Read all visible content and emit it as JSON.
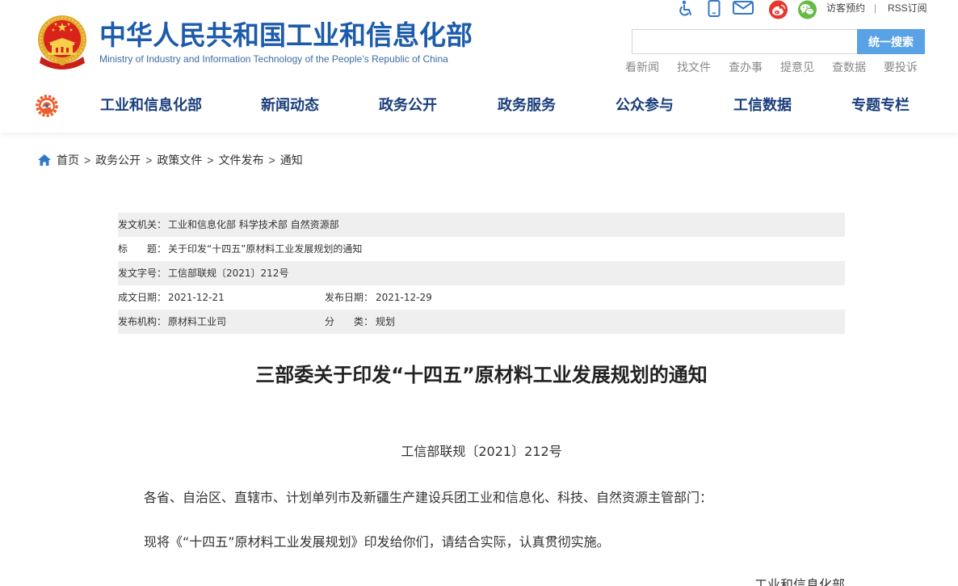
{
  "header": {
    "title": "中华人民共和国工业和信息化部",
    "subtitle": "Ministry of Industry and Information Technology of the People’s Republic of China",
    "top_links": {
      "visitor": "访客预约",
      "separator": "|",
      "rss": "RSS订阅"
    },
    "search": {
      "button_label": "统一搜索"
    },
    "quick_links": [
      "看新闻",
      "找文件",
      "查办事",
      "提意见",
      "查数据",
      "要投诉"
    ]
  },
  "nav": {
    "items": [
      "工业和信息化部",
      "新闻动态",
      "政务公开",
      "政务服务",
      "公众参与",
      "工信数据",
      "专题专栏"
    ]
  },
  "breadcrumb": {
    "items": [
      "首页",
      "政务公开",
      "政策文件",
      "文件发布",
      "通知"
    ],
    "separator": ">"
  },
  "doc_info": {
    "issuer": {
      "label": "发文机关：",
      "value": "工业和信息化部 科学技术部 自然资源部"
    },
    "title": {
      "label": "标　　题：",
      "value": "关于印发“十四五”原材料工业发展规划的通知"
    },
    "doc_no": {
      "label": "发文字号：",
      "value": "工信部联规〔2021〕212号"
    },
    "written_date": {
      "label": "成文日期：",
      "value": "2021-12-21"
    },
    "publish_date": {
      "label": "发布日期：",
      "value": "2021-12-29"
    },
    "agency": {
      "label": "发布机构：",
      "value": "原材料工业司"
    },
    "category": {
      "label": "分　　类：",
      "value": "规划"
    }
  },
  "article": {
    "title": "三部委关于印发“十四五”原材料工业发展规划的通知",
    "doc_no": "工信部联规〔2021〕212号",
    "paragraphs": [
      "各省、自治区、直辖市、计划单列市及新疆生产建设兵团工业和信息化、科技、自然资源主管部门：",
      "现将《“十四五”原材料工业发展规划》印发给你们，请结合实际，认真贯彻实施。"
    ],
    "signature": "工业和信息化部"
  },
  "icons": {
    "emblem": "national-emblem-icon",
    "nav_logo": "ministry-logo-icon",
    "accessibility": "accessibility-icon",
    "mobile": "mobile-icon",
    "mail": "mail-icon",
    "weibo": "weibo-icon",
    "wechat": "wechat-icon",
    "home": "home-icon"
  },
  "colors": {
    "brand-blue": "#1d5cab",
    "nav-text": "#1a3e7c",
    "icon-blue": "#3478c6",
    "search-button": "#5aa2e6",
    "row-gray": "#efefef",
    "weibo-red": "#e8362c",
    "wechat-green": "#64bb46"
  }
}
